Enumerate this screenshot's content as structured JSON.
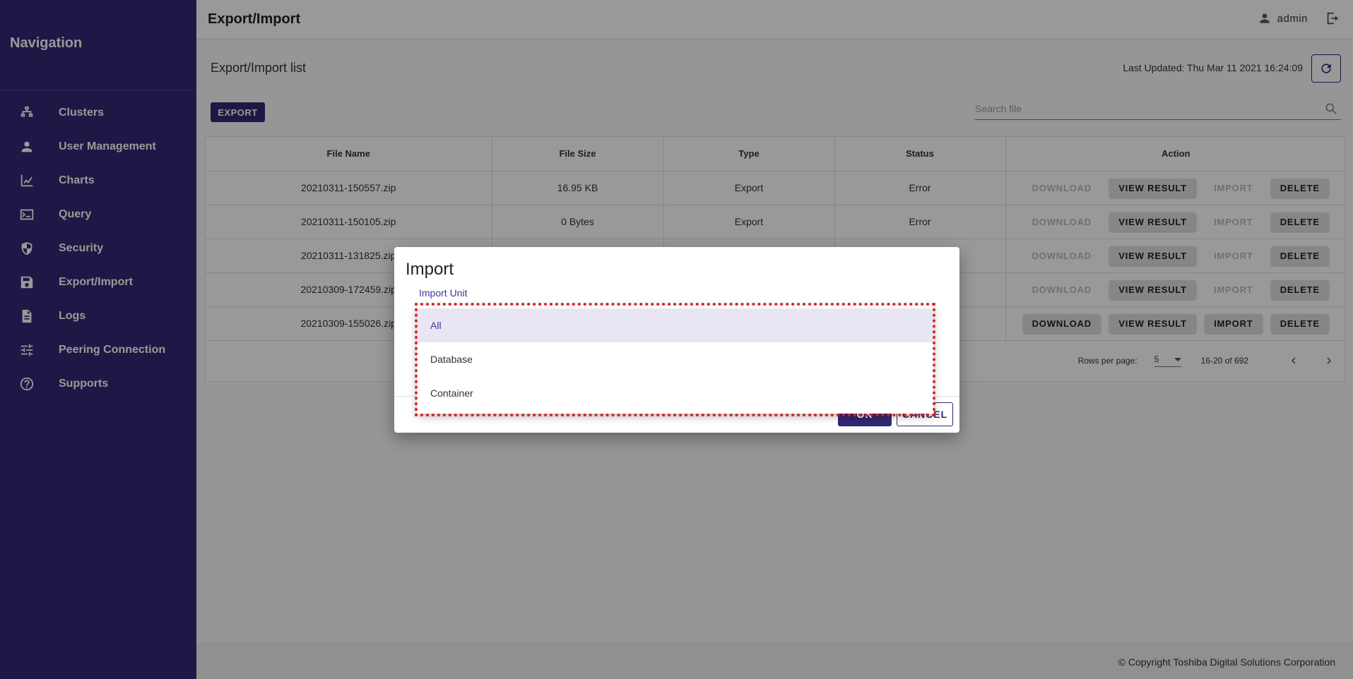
{
  "sidebar": {
    "title": "Navigation",
    "items": [
      {
        "label": "Clusters",
        "icon": "sitemap-icon"
      },
      {
        "label": "User Management",
        "icon": "person-icon"
      },
      {
        "label": "Charts",
        "icon": "line-chart-icon"
      },
      {
        "label": "Query",
        "icon": "terminal-icon"
      },
      {
        "label": "Security",
        "icon": "shield-icon"
      },
      {
        "label": "Export/Import",
        "icon": "save-icon"
      },
      {
        "label": "Logs",
        "icon": "document-icon"
      },
      {
        "label": "Peering Connection",
        "icon": "tune-icon"
      },
      {
        "label": "Supports",
        "icon": "help-circle-icon"
      }
    ]
  },
  "header": {
    "title": "Export/Import",
    "user": "admin"
  },
  "main": {
    "list_title": "Export/Import list",
    "last_updated": "Last Updated: Thu Mar 11 2021 16:24:09",
    "export_label": "EXPORT",
    "search_placeholder": "Search file",
    "table": {
      "headers": [
        "File Name",
        "File Size",
        "Type",
        "Status",
        "Action"
      ],
      "rows": [
        {
          "file": "20210311-150557.zip",
          "size": "16.95 KB",
          "type": "Export",
          "status": "Error",
          "download_enabled": false,
          "import_enabled": false
        },
        {
          "file": "20210311-150105.zip",
          "size": "0 Bytes",
          "type": "Export",
          "status": "Error",
          "download_enabled": false,
          "import_enabled": false
        },
        {
          "file": "20210311-131825.zip",
          "size": "",
          "type": "",
          "status": "",
          "download_enabled": false,
          "import_enabled": false
        },
        {
          "file": "20210309-172459.zip",
          "size": "",
          "type": "",
          "status": "",
          "download_enabled": false,
          "import_enabled": false
        },
        {
          "file": "20210309-155026.zip",
          "size": "",
          "type": "",
          "status": "",
          "download_enabled": true,
          "import_enabled": true
        }
      ],
      "action_labels": {
        "download": "DOWNLOAD",
        "view_result": "VIEW RESULT",
        "import": "IMPORT",
        "delete": "DELETE"
      }
    },
    "pagination": {
      "rows_per_page_label": "Rows per page:",
      "rows_per_page": "5",
      "range": "16-20 of 692"
    }
  },
  "dialog": {
    "title": "Import",
    "field_label": "Import Unit",
    "options": [
      "All",
      "Database",
      "Container"
    ],
    "selected": "All",
    "ok_label": "OK",
    "cancel_label": "CANCEL"
  },
  "footer": {
    "copyright": "© Copyright Toshiba Digital Solutions Corporation"
  },
  "colors": {
    "sidebar": "#312873",
    "accent": "#3f3896",
    "highlight": "#e01e1e"
  }
}
